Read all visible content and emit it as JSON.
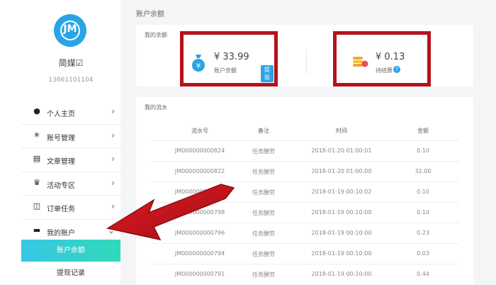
{
  "user": {
    "name": "简媒☑",
    "phone": "13661101104",
    "logo_text": "JM"
  },
  "menu": [
    {
      "icon": "person-icon",
      "label": "个人主页"
    },
    {
      "icon": "asterisk-icon",
      "label": "账号管理"
    },
    {
      "icon": "document-icon",
      "label": "文章管理"
    },
    {
      "icon": "crown-icon",
      "label": "活动专区"
    },
    {
      "icon": "briefcase-icon",
      "label": "订单任务"
    },
    {
      "icon": "wallet-icon",
      "label": "我的账户"
    }
  ],
  "submenu": {
    "active": "账户余额",
    "second": "提现记录"
  },
  "breadcrumb": "账户余额",
  "balance_card": {
    "title": "我的余额",
    "balance_amount": "¥ 33.99",
    "balance_label": "账户余额",
    "withdraw_label": "提现",
    "pending_amount": "¥ 0.13",
    "pending_label": "待结算",
    "help_mark": "?"
  },
  "flow": {
    "title": "我的流水",
    "headers": [
      "流水号",
      "备注",
      "时间",
      "金额"
    ],
    "rows": [
      [
        "JM000000000824",
        "任务酬劳",
        "2018-01-20 01:00:01",
        "0.10"
      ],
      [
        "JM000000000822",
        "任务酬劳",
        "2018-01-20 01:00:00",
        "32.00"
      ],
      [
        "JM000000000800",
        "任务酬劳",
        "2018-01-19 00:10:02",
        "0.10"
      ],
      [
        "JM000000000798",
        "任务酬劳",
        "2018-01-19 00:10:00",
        "0.10"
      ],
      [
        "JM000000000796",
        "任务酬劳",
        "2018-01-19 00:10:00",
        "0.23"
      ],
      [
        "JM000000000794",
        "任务酬劳",
        "2018-01-19 00:10:00",
        "0.03"
      ],
      [
        "JM000000000791",
        "任务酬劳",
        "2018-01-19 00:10:00",
        "0.44"
      ]
    ]
  },
  "colors": {
    "accent": "#2aa4e6",
    "highlight": "#b5121b",
    "active_gradient_start": "#38c7e6",
    "active_gradient_end": "#2fd9b8"
  }
}
